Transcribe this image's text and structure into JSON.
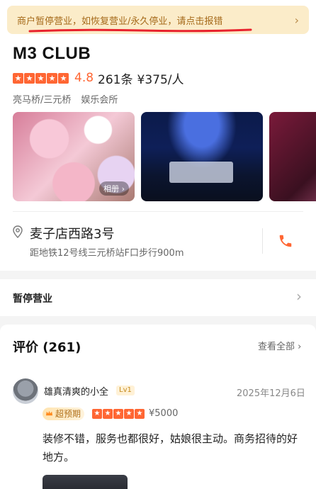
{
  "notice": {
    "text": "商户暂停营业，如恢复营业/永久停业，请点击报错",
    "chevron_icon": "chevron-right-icon",
    "highlight_color": "#e8222d"
  },
  "shop": {
    "name": "M3 CLUB",
    "rating_stars": 5,
    "score": "4.8",
    "review_count_text": "261条",
    "price_text": "¥375/人",
    "tags": [
      "亮马桥/三元桥",
      "娱乐会所"
    ],
    "album_label": "相册 ›",
    "accent_color": "#ff6633"
  },
  "address": {
    "icon": "location-pin-icon",
    "line": "麦子店西路3号",
    "subline": "距地铁12号线三元桥站F口步行900m",
    "call_icon": "phone-icon"
  },
  "status": {
    "label": "暂停营业",
    "chevron": "›"
  },
  "reviews": {
    "title": "评价 (261)",
    "view_all": "查看全部 ›",
    "items": [
      {
        "user": "雄真清爽的小全",
        "level": "Lv1",
        "date": "2025年12月6日",
        "badge": "超预期",
        "stars": 5,
        "price": "¥5000",
        "text": "装修不错，服务也都很好，姑娘很主动。商务招待的好地方。"
      }
    ]
  }
}
